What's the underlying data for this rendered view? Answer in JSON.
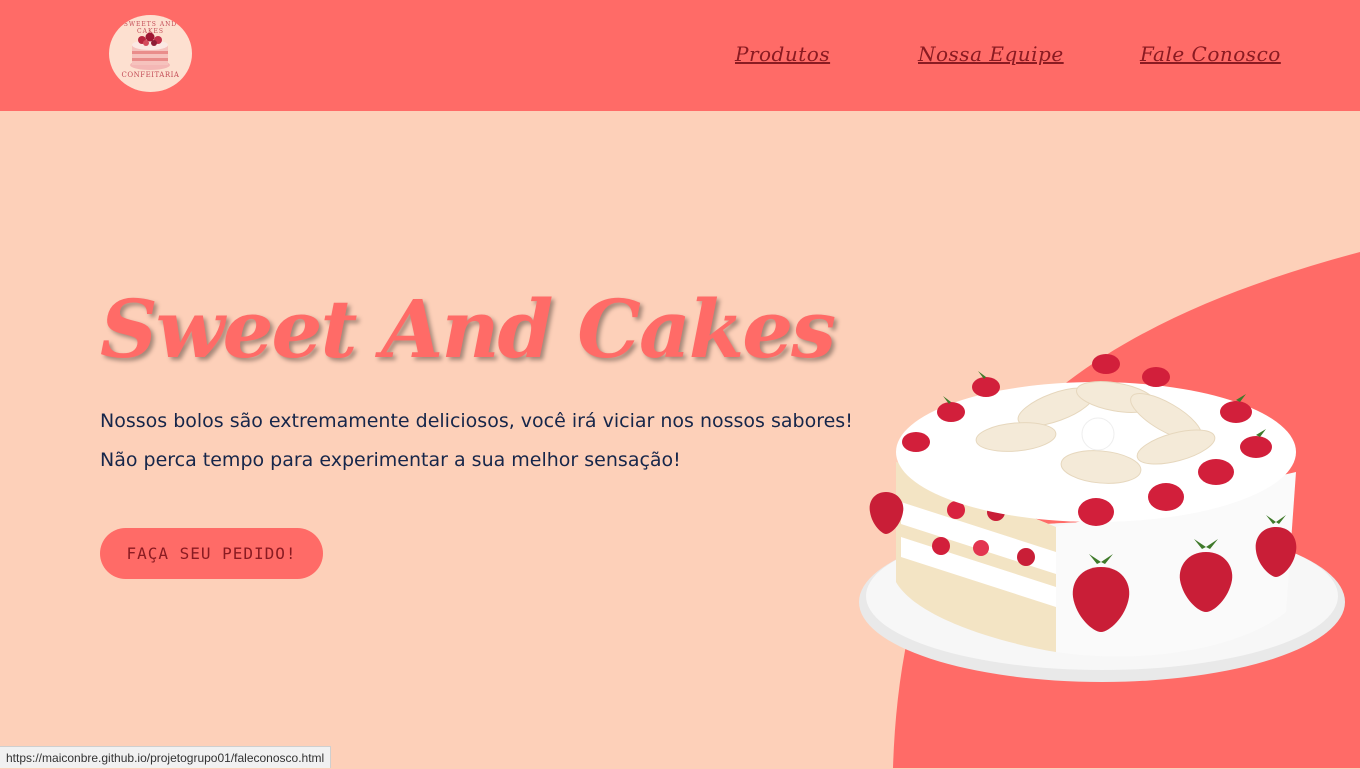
{
  "header": {
    "logo": {
      "top_text": "SWEETS AND CAKES",
      "bottom_text": "CONFEITARIA"
    },
    "nav": {
      "products": "Produtos",
      "team": "Nossa Equipe",
      "contact": "Fale Conosco"
    }
  },
  "hero": {
    "title": "Sweet And Cakes",
    "line1": "Nossos bolos são extremamente deliciosos, você irá viciar nos nossos sabores!",
    "line2": "Não perca tempo para experimentar a sua melhor sensação!",
    "cta": "FAÇA SEU PEDIDO!"
  },
  "status_bar": {
    "url": "https://maiconbre.github.io/projetogrupo01/faleconosco.html"
  },
  "colors": {
    "header_bg": "#ff6b67",
    "page_bg": "#fdd0b9",
    "accent": "#ff6b67",
    "nav_text": "#8a1b22",
    "body_text": "#16264a"
  }
}
